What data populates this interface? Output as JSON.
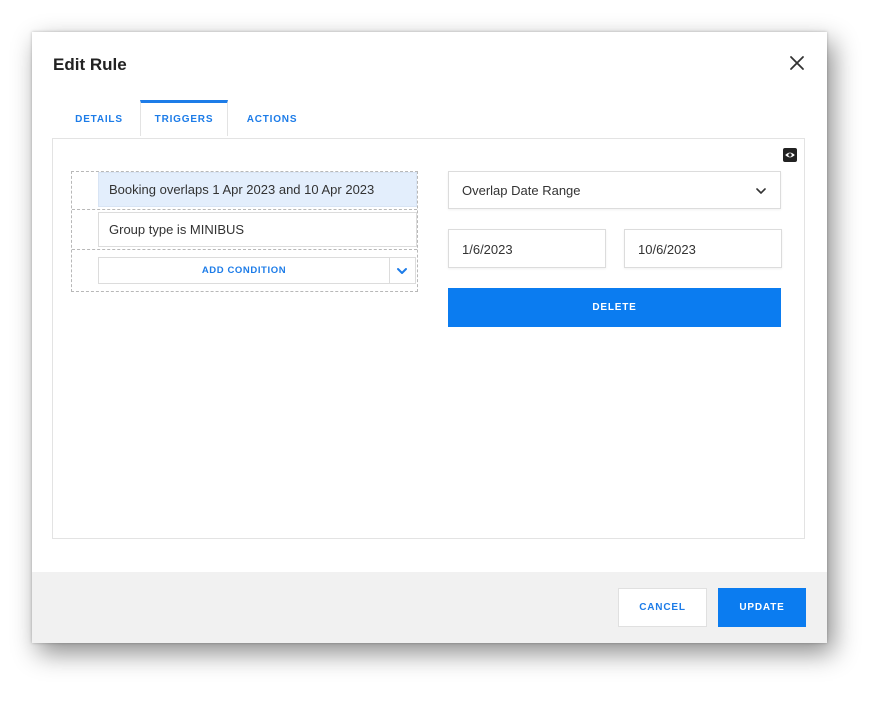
{
  "dialog": {
    "title": "Edit Rule",
    "close_icon": "close-icon"
  },
  "tabs": [
    {
      "label": "DETAILS",
      "active": false
    },
    {
      "label": "TRIGGERS",
      "active": true
    },
    {
      "label": "ACTIONS",
      "active": false
    }
  ],
  "triggers": {
    "preview_icon": "eye-icon",
    "conditions": [
      {
        "text": "Booking overlaps 1 Apr 2023 and 10 Apr 2023",
        "selected": true
      },
      {
        "text": "Group type is MINIBUS",
        "selected": false
      }
    ],
    "add_condition_label": "ADD CONDITION",
    "detail": {
      "condition_type": "Overlap Date Range",
      "start_date": "1/6/2023",
      "end_date": "10/6/2023",
      "delete_label": "DELETE"
    }
  },
  "footer": {
    "cancel_label": "CANCEL",
    "update_label": "UPDATE"
  },
  "colors": {
    "accent": "#0b7cf0",
    "selected_row": "#e3eefc",
    "footer_bg": "#f1f1f1"
  }
}
